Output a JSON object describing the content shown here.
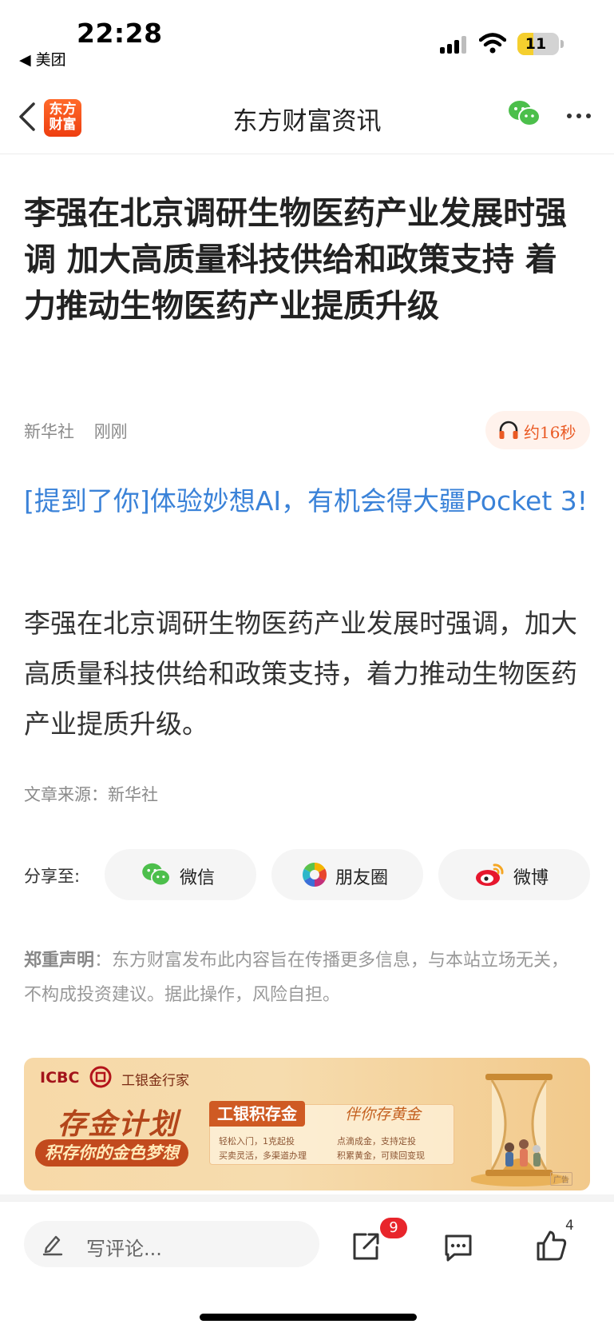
{
  "status_bar": {
    "time": "22:28",
    "back_app": "◀ 美团",
    "battery": "11"
  },
  "nav": {
    "logo_text_line1": "东方",
    "logo_text_line2": "财富",
    "title": "东方财富资讯"
  },
  "article": {
    "headline": "李强在北京调研生物医药产业发展时强调 加大高质量科技供给和政策支持 着力推动生物医药产业提质升级",
    "source_name": "新华社",
    "time": "刚刚",
    "audio_duration": "约16秒",
    "promo_link": "[提到了你]体验妙想AI，有机会得大疆Pocket 3!",
    "body": "李强在北京调研生物医药产业发展时强调，加大高质量科技供给和政策支持，着力推动生物医药产业提质升级。",
    "source_line": "文章来源：新华社"
  },
  "share": {
    "label": "分享至:",
    "buttons": [
      {
        "label": "微信",
        "icon": "wechat-icon"
      },
      {
        "label": "朋友圈",
        "icon": "moments-icon"
      },
      {
        "label": "微博",
        "icon": "weibo-icon"
      }
    ]
  },
  "disclaimer": {
    "title": "郑重声明",
    "text": "：东方财富发布此内容旨在传播更多信息，与本站立场无关，不构成投资建议。据此操作，风险自担。"
  },
  "ad": {
    "brand": "ICBC",
    "brand_cn": "工银金行家",
    "title": "存金计划",
    "subtitle": "积存你的金色梦想",
    "product": "工银积存金",
    "slogan": "伴你存黄金",
    "items": [
      "轻松入门，1克起投",
      "点滴成金，支持定投",
      "买卖灵活，多渠道办理",
      "积累黄金，可赎回变现"
    ],
    "tag": "广告"
  },
  "bottom_bar": {
    "comment_placeholder": "写评论...",
    "share_badge": "9",
    "like_count": "4"
  },
  "colors": {
    "accent": "#ea5a24",
    "link": "#3a82d8",
    "badge": "#e8252b"
  }
}
